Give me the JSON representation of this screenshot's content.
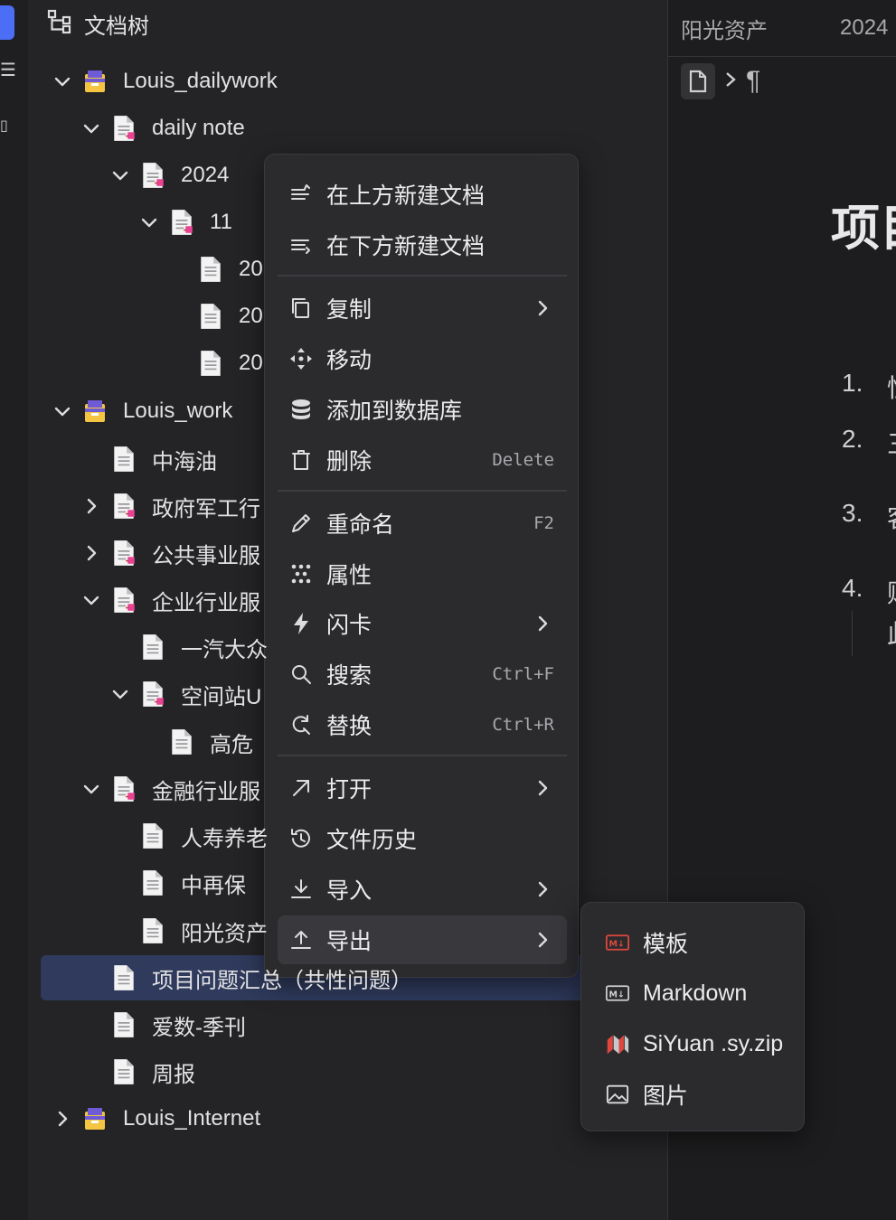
{
  "tree": {
    "header": "文档树",
    "rows": [
      {
        "label": "Louis_dailywork",
        "icon": "notebook-icon",
        "arrow": "down"
      },
      {
        "label": "daily note",
        "icon": "doc-folder-icon",
        "arrow": "down"
      },
      {
        "label": "2024",
        "icon": "doc-folder-icon",
        "arrow": "down"
      },
      {
        "label": "11",
        "icon": "doc-folder-icon",
        "arrow": "down"
      },
      {
        "label": "20",
        "icon": "doc-icon",
        "arrow": "none"
      },
      {
        "label": "20",
        "icon": "doc-icon",
        "arrow": "none"
      },
      {
        "label": "20",
        "icon": "doc-icon",
        "arrow": "none"
      },
      {
        "label": "Louis_work",
        "icon": "notebook-icon",
        "arrow": "down"
      },
      {
        "label": "中海油",
        "icon": "doc-icon",
        "arrow": "none"
      },
      {
        "label": "政府军工行",
        "icon": "doc-folder-icon",
        "arrow": "right"
      },
      {
        "label": "公共事业服",
        "icon": "doc-folder-icon",
        "arrow": "right"
      },
      {
        "label": "企业行业服",
        "icon": "doc-folder-icon",
        "arrow": "down"
      },
      {
        "label": "一汽大众",
        "icon": "doc-icon",
        "arrow": "none"
      },
      {
        "label": "空间站U",
        "icon": "doc-folder-icon",
        "arrow": "down"
      },
      {
        "label": "高危",
        "icon": "doc-icon",
        "arrow": "none"
      },
      {
        "label": "金融行业服",
        "icon": "doc-folder-icon",
        "arrow": "down"
      },
      {
        "label": "人寿养老",
        "icon": "doc-icon",
        "arrow": "none"
      },
      {
        "label": "中再保",
        "icon": "doc-icon",
        "arrow": "none"
      },
      {
        "label": "阳光资产",
        "icon": "doc-icon",
        "arrow": "none"
      },
      {
        "label": "项目问题汇总（共性问题）",
        "icon": "doc-icon",
        "arrow": "none",
        "selected": true
      },
      {
        "label": "爱数-季刊",
        "icon": "doc-icon",
        "arrow": "none"
      },
      {
        "label": "周报",
        "icon": "doc-icon",
        "arrow": "none"
      },
      {
        "label": "Louis_Internet",
        "icon": "notebook-icon",
        "arrow": "right"
      }
    ]
  },
  "editor": {
    "tab1": "阳光资产",
    "tab2": "2024",
    "title": "项目",
    "list": [
      {
        "n": "1.",
        "t": "性"
      },
      {
        "n": "2.",
        "t": "三"
      },
      {
        "n": "3.",
        "t": "客"
      },
      {
        "n": "4.",
        "t": "财"
      }
    ],
    "continuation": "此"
  },
  "menu": {
    "items": [
      {
        "label": "在上方新建文档",
        "icon": "insert-above-icon"
      },
      {
        "label": "在下方新建文档",
        "icon": "insert-below-icon"
      },
      {
        "label": "复制",
        "icon": "copy-icon",
        "submenu": true
      },
      {
        "label": "移动",
        "icon": "move-icon"
      },
      {
        "label": "添加到数据库",
        "icon": "database-icon"
      },
      {
        "label": "删除",
        "icon": "trash-icon",
        "shortcut": "Delete"
      },
      {
        "label": "重命名",
        "icon": "edit-icon",
        "shortcut": "F2"
      },
      {
        "label": "属性",
        "icon": "attributes-icon"
      },
      {
        "label": "闪卡",
        "icon": "flashcard-icon",
        "submenu": true
      },
      {
        "label": "搜索",
        "icon": "search-icon",
        "shortcut": "Ctrl+F"
      },
      {
        "label": "替换",
        "icon": "replace-icon",
        "shortcut": "Ctrl+R"
      },
      {
        "label": "打开",
        "icon": "open-icon",
        "submenu": true
      },
      {
        "label": "文件历史",
        "icon": "history-icon"
      },
      {
        "label": "导入",
        "icon": "import-icon",
        "submenu": true
      },
      {
        "label": "导出",
        "icon": "export-icon",
        "submenu": true,
        "hover": true
      }
    ]
  },
  "submenu": {
    "items": [
      {
        "label": "模板",
        "icon": "markdown-template-icon"
      },
      {
        "label": "Markdown",
        "icon": "markdown-icon"
      },
      {
        "label": "SiYuan .sy.zip",
        "icon": "siyuan-icon"
      },
      {
        "label": "图片",
        "icon": "image-icon"
      }
    ]
  },
  "colors": {
    "accent": "#4c6ef5",
    "selection": "#2f3a5c",
    "template_red": "#e0473c"
  }
}
